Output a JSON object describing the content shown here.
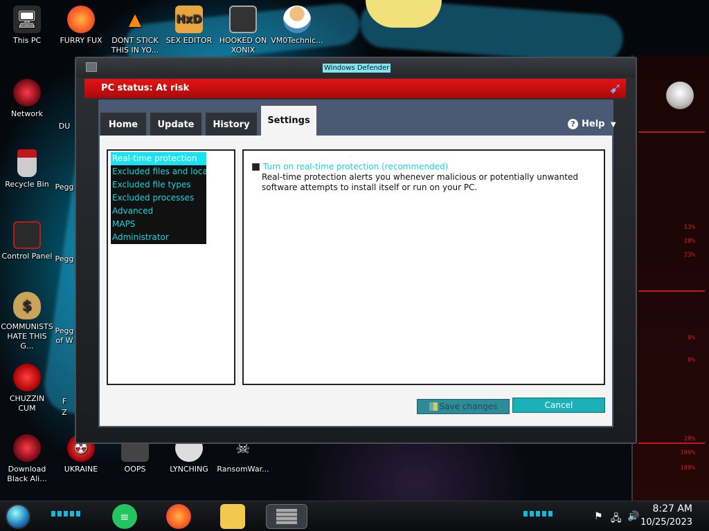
{
  "desktop": {
    "icons": [
      {
        "label": "This PC",
        "icon": "computer-icon",
        "color": "#2b2b2b"
      },
      {
        "label": "FURRY FUX",
        "icon": "firefox-icon",
        "color": "#ff7a1a"
      },
      {
        "label": "DONT STICK THIS IN YO...",
        "icon": "vlc-icon",
        "color": "#ff8800"
      },
      {
        "label": "SEX EDITOR",
        "icon": "hxd-icon",
        "color": "#e8a640"
      },
      {
        "label": "HOOKED ON XONIX",
        "icon": "xonix-icon",
        "color": "#333333"
      },
      {
        "label": "VM0Technic...",
        "icon": "doctor-icon",
        "color": "#f0c080"
      },
      {
        "label": "Network",
        "icon": "network-icon",
        "color": "#b01020"
      },
      {
        "label": "Recycle Bin",
        "icon": "recycle-bin-icon",
        "color": "#c01818"
      },
      {
        "label": "Control Panel",
        "icon": "control-panel-icon",
        "color": "#c01818"
      },
      {
        "label": "COMMUNISTS HATE THIS G...",
        "icon": "money-bag-icon",
        "color": "#c9a45a"
      },
      {
        "label": "CHUZZIN CUM",
        "icon": "chuzzle-icon",
        "color": "#e01818"
      },
      {
        "label": "Download Black Ali...",
        "icon": "alien-orb-icon",
        "color": "#b01020"
      },
      {
        "label": "UKRAINE",
        "icon": "radiation-icon",
        "color": "#e02020"
      },
      {
        "label": "OOPS",
        "icon": "oops-icon",
        "color": "#555555"
      },
      {
        "label": "LYNCHING",
        "icon": "lynching-icon",
        "color": "#dddddd"
      },
      {
        "label": "RansomWar...",
        "icon": "skull-icon",
        "color": "#777777"
      }
    ],
    "partial_labels": [
      "DU",
      "Pegg",
      "Pegg",
      "Pegg",
      "F",
      "Z",
      "of W"
    ]
  },
  "side_panel": {
    "values": [
      "13%",
      "28%",
      "23%",
      "0%",
      "0%",
      "28%",
      "100%",
      "100%"
    ]
  },
  "window": {
    "title": "Windows Defender",
    "status": "PC status: At risk",
    "tabs": [
      {
        "label": "Home"
      },
      {
        "label": "Update"
      },
      {
        "label": "History"
      },
      {
        "label": "Settings",
        "active": true
      }
    ],
    "help_label": "Help",
    "nav": [
      {
        "label": "Real-time protection",
        "selected": true
      },
      {
        "label": "Excluded files and locat..."
      },
      {
        "label": "Excluded file types"
      },
      {
        "label": "Excluded processes"
      },
      {
        "label": "Advanced"
      },
      {
        "label": "MAPS"
      },
      {
        "label": "Administrator"
      }
    ],
    "realtime_checkbox_label": "Turn on real-time protection (recommended)",
    "realtime_checkbox_checked": true,
    "realtime_description": "Real-time protection alerts you whenever malicious or potentially unwanted software attempts to install itself or run on your PC.",
    "save_button": "Save changes",
    "cancel_button": "Cancel"
  },
  "taskbar": {
    "apps": [
      {
        "name": "notes-app-icon",
        "color": "#22c55e"
      },
      {
        "name": "firefox-icon",
        "color": "#ff7a1a"
      },
      {
        "name": "file-explorer-icon",
        "color": "#f2c94c"
      },
      {
        "name": "windows-defender-icon",
        "color": "#9a9a9a"
      }
    ],
    "time": "8:27 AM",
    "date": "10/25/2023"
  }
}
